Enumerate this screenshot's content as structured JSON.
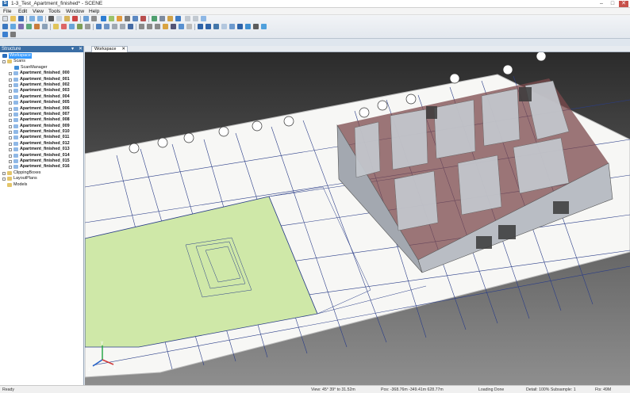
{
  "window": {
    "app_icon": "S",
    "title": "1-3_Test_Apartment_finished* - SCENE",
    "buttons": {
      "minimize": "–",
      "maximize": "□",
      "close": "✕"
    }
  },
  "menu": [
    "File",
    "Edit",
    "View",
    "Tools",
    "Window",
    "Help"
  ],
  "structure": {
    "header": "Structure",
    "pin_glyph": "▾",
    "close_glyph": "✕",
    "workspace": "Workspace",
    "scans_label": "Scans",
    "scan_manager": "ScanManager",
    "scans": [
      "Apartment_finished_000",
      "Apartment_finished_001",
      "Apartment_finished_002",
      "Apartment_finished_003",
      "Apartment_finished_004",
      "Apartment_finished_005",
      "Apartment_finished_006",
      "Apartment_finished_007",
      "Apartment_finished_008",
      "Apartment_finished_009",
      "Apartment_finished_010",
      "Apartment_finished_011",
      "Apartment_finished_012",
      "Apartment_finished_013",
      "Apartment_finished_014",
      "Apartment_finished_015",
      "Apartment_finished_016"
    ],
    "other": [
      "ClippingBoxes",
      "LayoutPlans",
      "Models"
    ]
  },
  "tabs": [
    {
      "label": "Workspace",
      "close": "✕"
    }
  ],
  "viewport": {
    "axis": {
      "x": "x",
      "y": "y",
      "z": "z"
    },
    "colors": {
      "background_top": "#2b2b2b",
      "background_bottom": "#8e8e8e",
      "paper": "#f7f7f5",
      "highlight": "#cfe8a8",
      "plan_line": "#2a3d88",
      "pointcloud_wall": "#b9bdc4",
      "pointcloud_floor": "#7c4a4c"
    }
  },
  "status": {
    "left": "Ready",
    "view": "View: 45°  39° to 31.52m",
    "pos": "Pos: -368.76m -349.41m 628.77m",
    "loading": "Loading Done",
    "detail": "Detail: 100%  Subsample: 1",
    "fps": "Fts: 49M"
  }
}
